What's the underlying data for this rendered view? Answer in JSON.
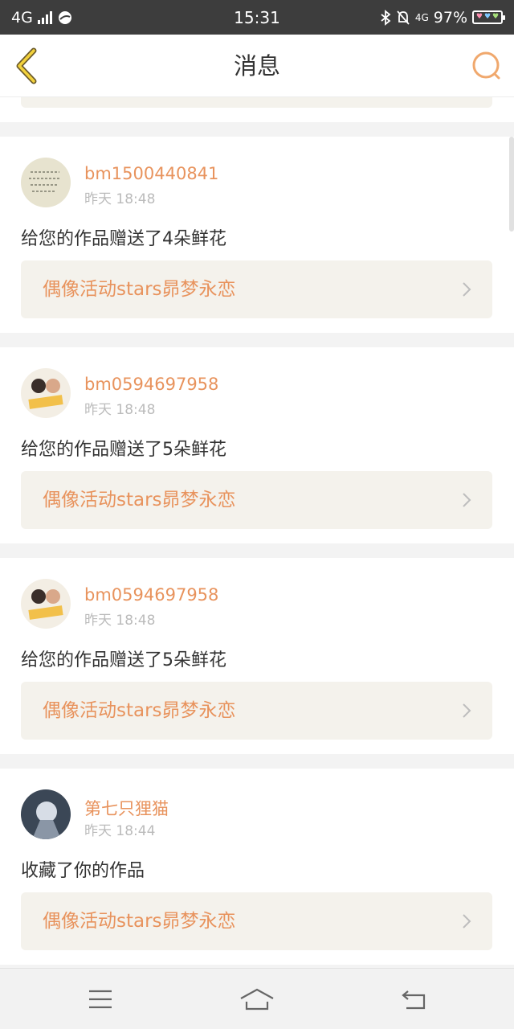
{
  "status_bar": {
    "network": "4G",
    "time": "15:31",
    "network_right": "4G",
    "battery": "97%",
    "icons": [
      "signal-icon",
      "data-icon",
      "bluetooth-icon",
      "mute-icon",
      "battery-icon"
    ]
  },
  "nav": {
    "title": "消息",
    "back_icon": "back-chevron-icon",
    "search_icon": "search-icon",
    "accent_color": "#e8935d"
  },
  "messages": [
    {
      "username": "bm1500440841",
      "time": "昨天 18:48",
      "text": "给您的作品赠送了4朵鲜花",
      "link": "偶像活动stars昴梦永恋"
    },
    {
      "username": "bm0594697958",
      "time": "昨天 18:48",
      "text": "给您的作品赠送了5朵鲜花",
      "link": "偶像活动stars昴梦永恋"
    },
    {
      "username": "bm0594697958",
      "time": "昨天 18:48",
      "text": "给您的作品赠送了5朵鲜花",
      "link": "偶像活动stars昴梦永恋"
    },
    {
      "username": "第七只狸猫",
      "time": "昨天 18:44",
      "text": "收藏了你的作品",
      "link": "偶像活动stars昴梦永恋"
    }
  ],
  "bottom_nav": {
    "icons": [
      "menu-icon",
      "home-icon",
      "back-icon"
    ]
  }
}
